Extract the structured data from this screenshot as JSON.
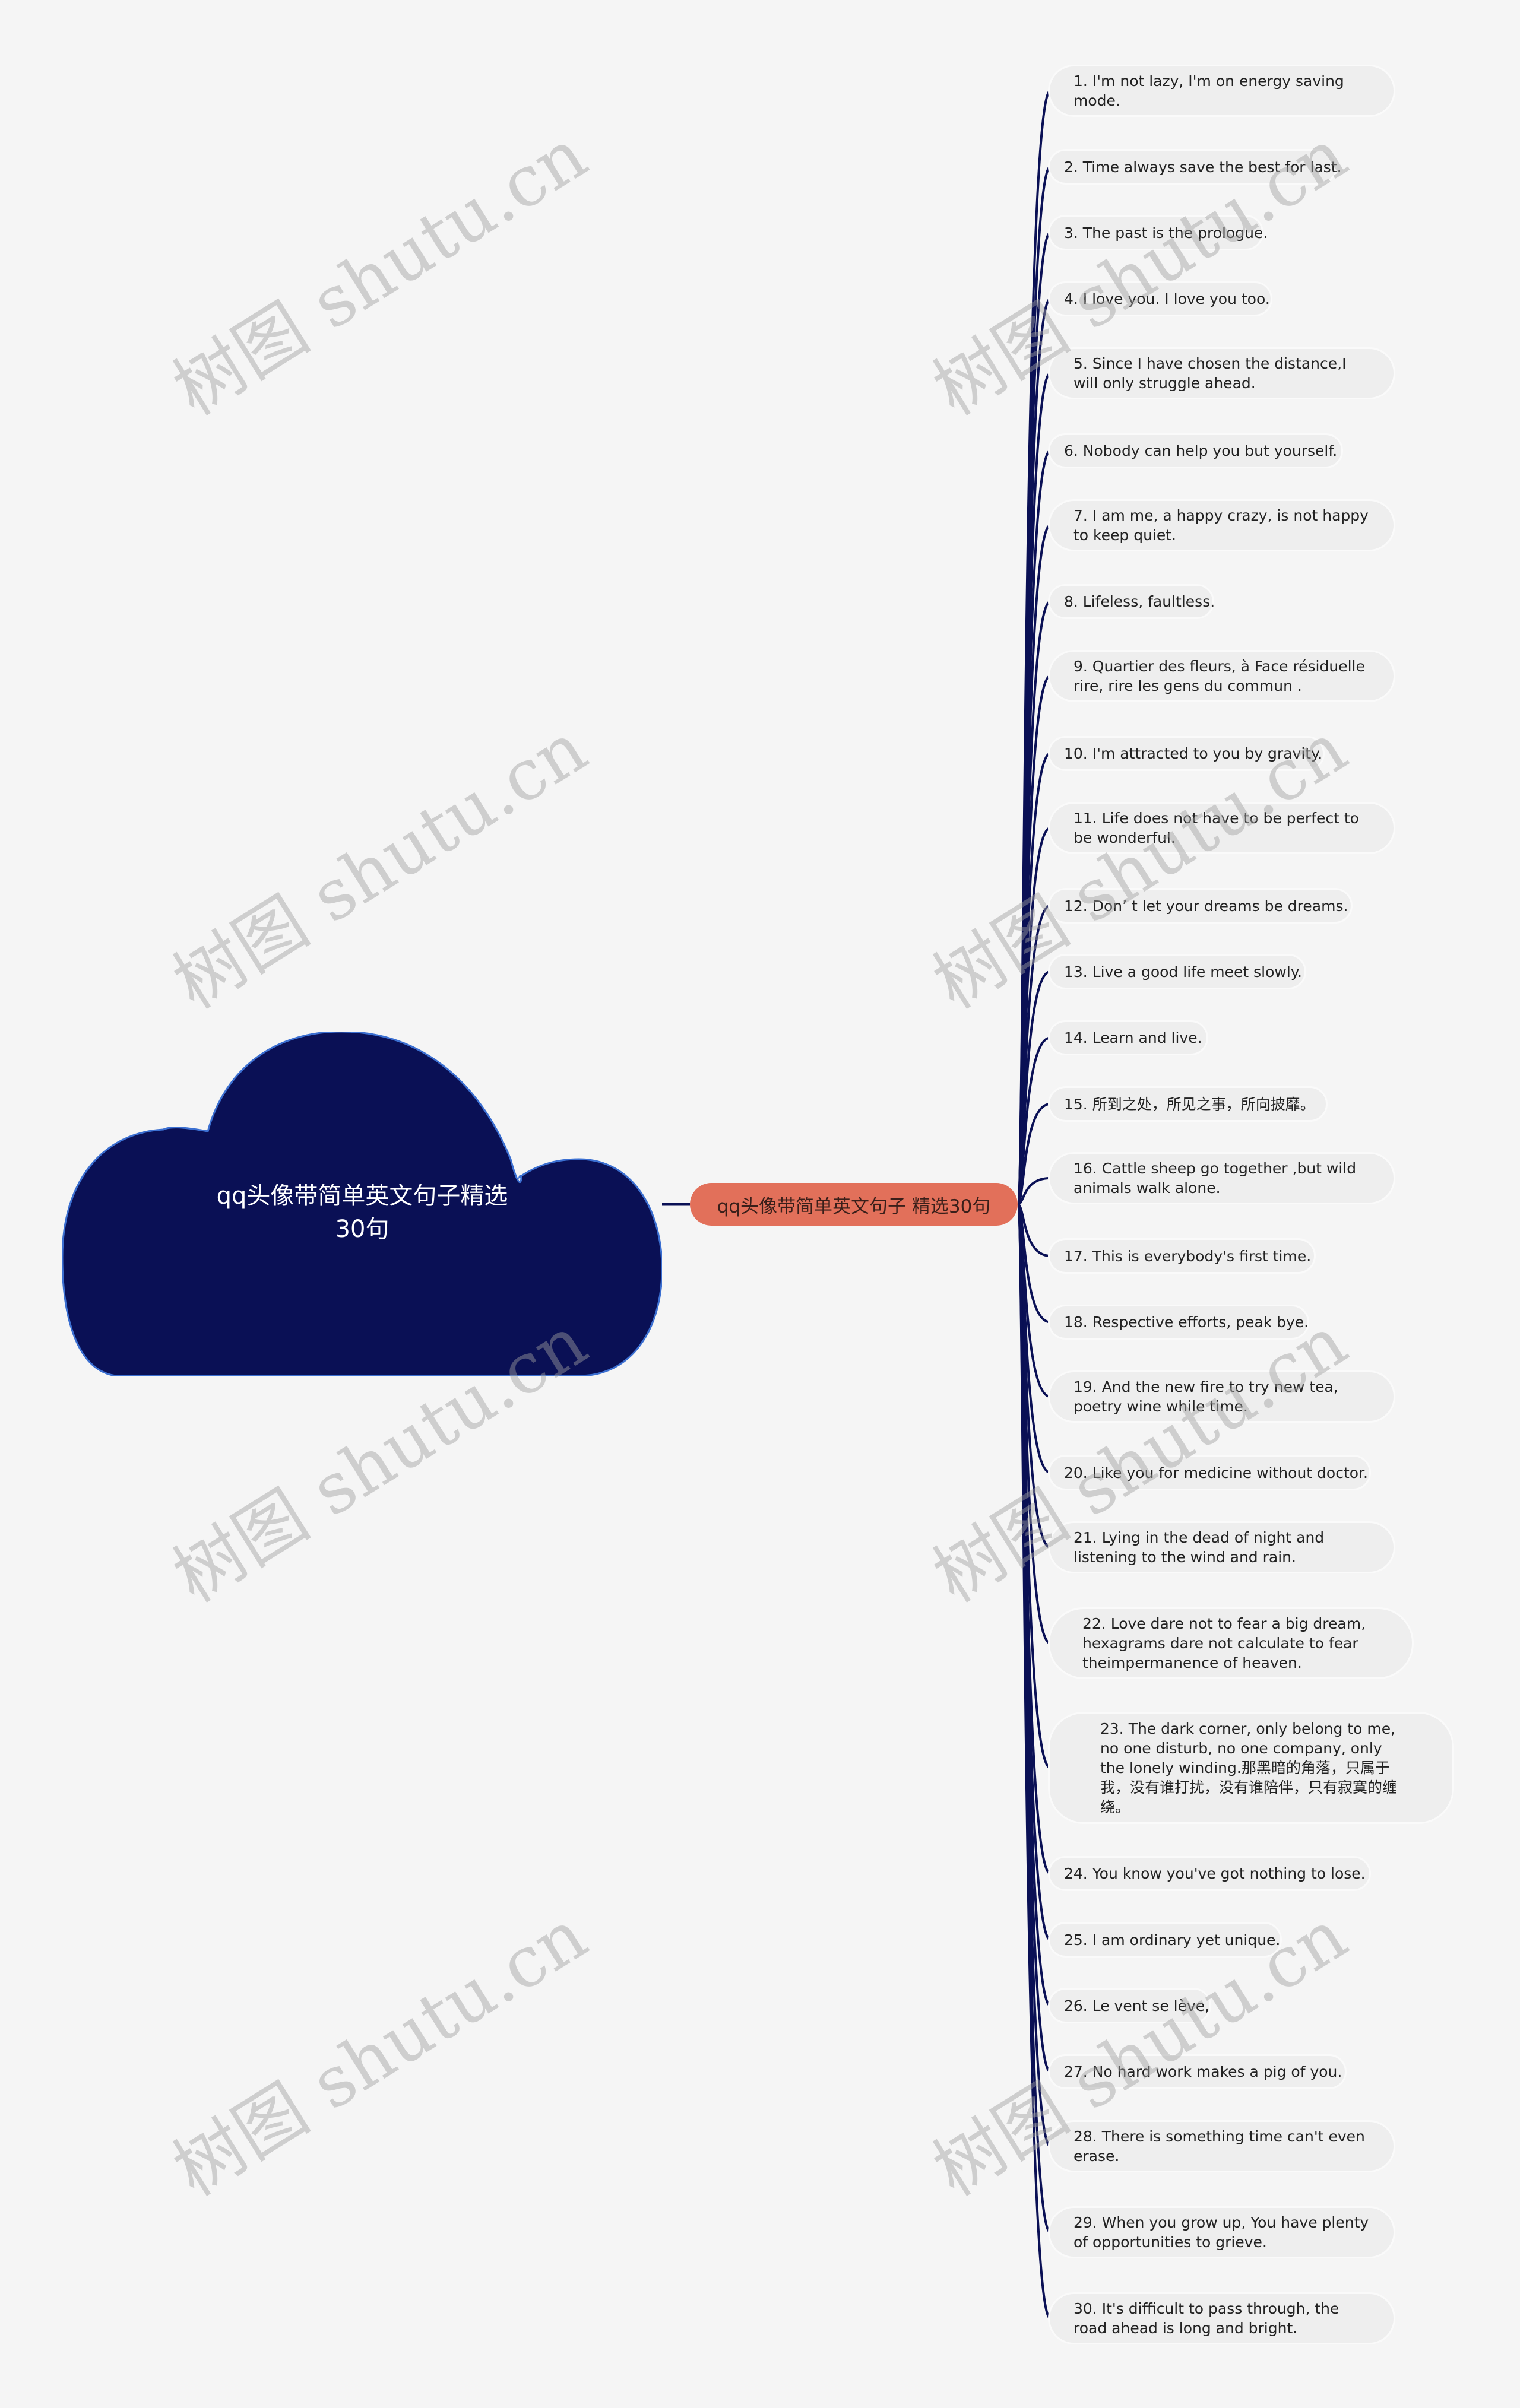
{
  "root": {
    "title": "qq头像带简单英文句子精选30句",
    "fill": "#0a1055",
    "stroke": "#3b6fd1"
  },
  "main_node": {
    "label": "qq头像带简单英文句子 精选30句",
    "fill": "#e2705a"
  },
  "link_color": "#0a1055",
  "watermark": "树图 shutu.cn",
  "items": [
    {
      "text": "1. I'm not lazy, I'm on energy saving mode."
    },
    {
      "text": "2. Time always save the best for last."
    },
    {
      "text": "3. The past is the prologue."
    },
    {
      "text": "4. I love you. I love you too."
    },
    {
      "text": "5. Since I have chosen the distance,I will only struggle ahead."
    },
    {
      "text": "6. Nobody can help you but yourself."
    },
    {
      "text": "7. I am me, a happy crazy, is not happy to keep quiet."
    },
    {
      "text": "8. Lifeless, faultless."
    },
    {
      "text": "9. Quartier des fleurs, à Face résiduelle rire, rire les gens du commun ."
    },
    {
      "text": "10. I'm attracted to you by gravity."
    },
    {
      "text": "11. Life does not have to be perfect to be wonderful."
    },
    {
      "text": "12. Don’ t let your dreams be dreams."
    },
    {
      "text": "13. Live a good life meet slowly."
    },
    {
      "text": "14. Learn and live."
    },
    {
      "text": "15. 所到之处，所见之事，所向披靡。"
    },
    {
      "text": "16. Cattle sheep go together ,but wild animals walk alone."
    },
    {
      "text": "17. This is  everybody's first time."
    },
    {
      "text": "18. Respective efforts, peak bye."
    },
    {
      "text": "19. And the new fire to try new tea, poetry wine while time."
    },
    {
      "text": "20. Like you for medicine without doctor."
    },
    {
      "text": "21. Lying in the dead of night and listening to  the wind and rain."
    },
    {
      "text": "22. Love dare not to fear a big dream, hexagrams dare not calculate to fear theimpermanence of heaven."
    },
    {
      "text": "23. The dark corner, only belong to me, no one disturb, no one company, only the lonely winding.那黑暗的角落，只属于我，没有谁打扰，没有谁陪伴，只有寂寞的缠绕。"
    },
    {
      "text": "24. You know you've got nothing to lose."
    },
    {
      "text": "25. I am ordinary yet unique."
    },
    {
      "text": "26. Le vent se lève,"
    },
    {
      "text": "27. No hard work makes a pig of you."
    },
    {
      "text": "28. There is something time can't even erase."
    },
    {
      "text": "29. When you grow up, You have plenty of opportunities to grieve."
    },
    {
      "text": "30. It's difficult to pass through, the road ahead is long and bright."
    }
  ]
}
